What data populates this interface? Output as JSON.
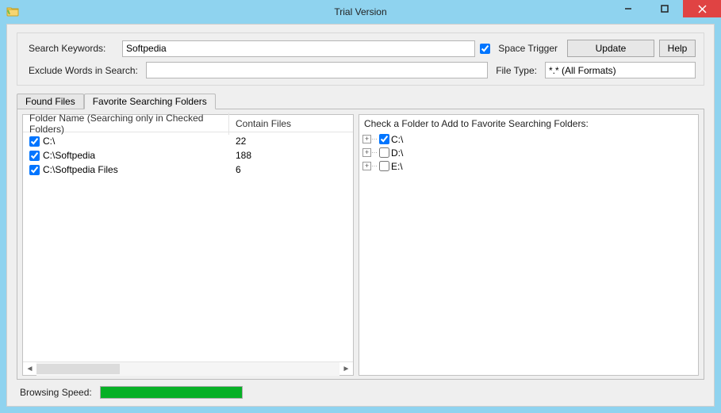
{
  "window": {
    "title": "Trial Version"
  },
  "top": {
    "search_keywords_label": "Search Keywords:",
    "search_keywords_value": "Softpedia",
    "space_trigger_label": "Space Trigger",
    "space_trigger_checked": true,
    "update_btn": "Update",
    "help_btn": "Help",
    "exclude_words_label": "Exclude Words in Search:",
    "exclude_words_value": "",
    "file_type_label": "File Type:",
    "file_type_value": "*.* (All Formats)"
  },
  "tabs": {
    "found_files": "Found Files",
    "favorite_folders": "Favorite Searching Folders",
    "active": "favorite_folders"
  },
  "left_pane": {
    "col_folder": "Folder Name (Searching only in Checked Folders)",
    "col_contain": "Contain Files",
    "rows": [
      {
        "checked": true,
        "path": "C:\\",
        "count": "22"
      },
      {
        "checked": true,
        "path": "C:\\Softpedia",
        "count": "188"
      },
      {
        "checked": true,
        "path": "C:\\Softpedia Files",
        "count": "6"
      }
    ]
  },
  "right_pane": {
    "header": "Check a Folder to Add to Favorite Searching Folders:",
    "nodes": [
      {
        "checked": true,
        "label": "C:\\"
      },
      {
        "checked": false,
        "label": "D:\\"
      },
      {
        "checked": false,
        "label": "E:\\"
      }
    ]
  },
  "bottom": {
    "browsing_speed_label": "Browsing Speed:",
    "progress_percent": 100
  }
}
